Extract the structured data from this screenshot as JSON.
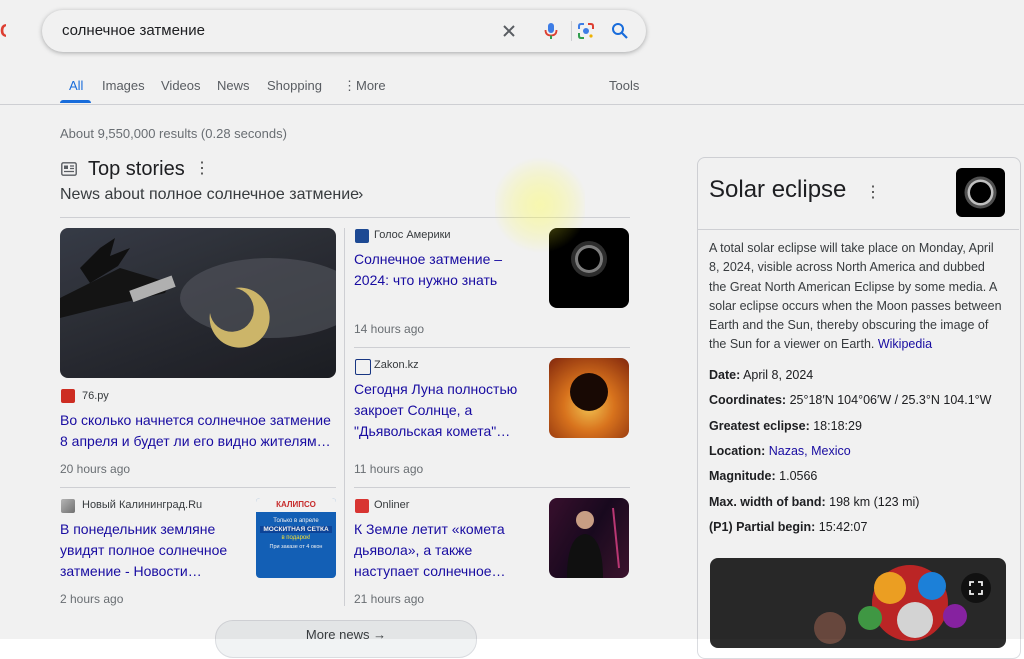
{
  "search": {
    "query": "солнечное затмение"
  },
  "tabs": [
    "All",
    "Images",
    "Videos",
    "News",
    "Shopping",
    "More"
  ],
  "tools_label": "Tools",
  "result_stats": "About 9,550,000 results (0.28 seconds)",
  "top_stories": {
    "title": "Top stories",
    "subtitle": "News about полное солнечное затмение",
    "stories": [
      {
        "source": "76.ру",
        "headline": "Во сколько начнется солнечное затмение 8 апреля и будет ли его видно жителям…",
        "age": "20 hours ago"
      },
      {
        "source": "Голос Америки",
        "headline": "Солнечное затмение – 2024: что нужно знать",
        "age": "14 hours ago"
      },
      {
        "source": "Zakon.kz",
        "headline": "Сегодня Луна полностью закроет Солнце, а \"Дьявольская комета\"…",
        "age": "11 hours ago"
      },
      {
        "source": "Новый Калининград.Ru",
        "headline": "В понедельник земляне увидят полное солнечное затмение - Новости…",
        "age": "2 hours ago"
      },
      {
        "source": "Onliner",
        "headline": "К Земле летит «комета дьявола», а также наступает солнечное…",
        "age": "21 hours ago"
      }
    ],
    "ad_thumb": {
      "brand": "КАЛИПСО",
      "line1": "Только в апреле",
      "line2": "МОСКИТНАЯ СЕТКА",
      "line3": "в подарок!",
      "line4": "При заказе от 4 окон"
    },
    "more_news": "More news"
  },
  "knowledge_panel": {
    "title": "Solar eclipse",
    "description": "A total solar eclipse will take place on Monday, April 8, 2024, visible across North America and dubbed the Great North American Eclipse by some media. A solar eclipse occurs when the Moon passes between Earth and the Sun, thereby obscuring the image of the Sun for a viewer on Earth.",
    "description_link": "Wikipedia",
    "facts": [
      {
        "label": "Date:",
        "value": "April 8, 2024"
      },
      {
        "label": "Coordinates:",
        "value": "25°18′N 104°06′W / 25.3°N 104.1°W"
      },
      {
        "label": "Greatest eclipse:",
        "value": "18:18:29"
      },
      {
        "label": "Location:",
        "value": "Nazas, Mexico"
      },
      {
        "label": "Magnitude:",
        "value": "1.0566"
      },
      {
        "label": "Max. width of band:",
        "value": "198 km (123 mi)"
      },
      {
        "label": "(P1) Partial begin:",
        "value": "15:42:07"
      }
    ]
  },
  "colors": {
    "link": "#1a0dab",
    "accent": "#1a73e8",
    "crescent": "#f5f000"
  }
}
